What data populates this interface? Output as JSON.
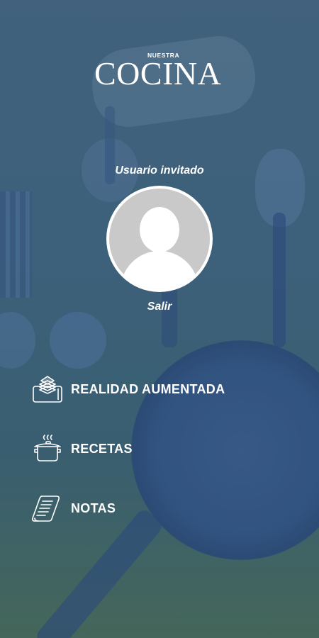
{
  "brand": {
    "kicker": "NUESTRA",
    "name": "COCINA"
  },
  "profile": {
    "username": "Usuario invitado",
    "logout_label": "Salir"
  },
  "menu": [
    {
      "label": "REALIDAD AUMENTADA",
      "icon": "augmented-reality-icon"
    },
    {
      "label": "RECETAS",
      "icon": "cooking-pot-icon"
    },
    {
      "label": "NOTAS",
      "icon": "notes-scroll-icon"
    }
  ],
  "colors": {
    "text": "#ffffff",
    "avatar_bg": "#c9c9c9"
  }
}
